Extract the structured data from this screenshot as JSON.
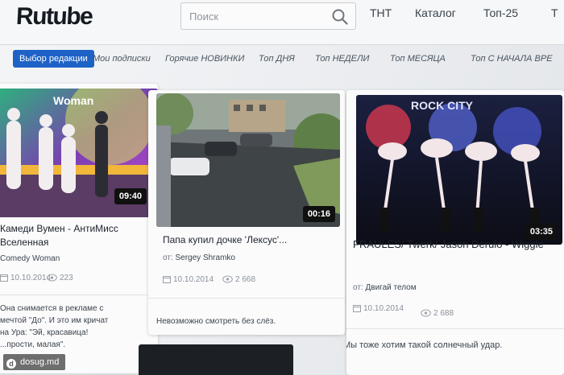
{
  "header": {
    "logo": "Rutube",
    "search_placeholder": "Поиск",
    "nav": [
      "ТНТ",
      "Каталог",
      "Топ-25",
      "Т"
    ]
  },
  "tabs": [
    {
      "label": "Выбор редакции",
      "active": true
    },
    {
      "label": "Мои подписки"
    },
    {
      "label": "Горячие НОВИНКИ"
    },
    {
      "label": "Топ ДНЯ"
    },
    {
      "label": "Топ НЕДЕЛИ"
    },
    {
      "label": "Топ МЕСЯЦА"
    },
    {
      "label": "Топ С НАЧАЛА ВРЕ"
    }
  ],
  "cards": [
    {
      "thumb_text": "Woman",
      "duration": "09:40",
      "title": "Камеди Вумен - АнтиМисс Вселенная",
      "author": "Comedy Woman",
      "date": "10.10.2014",
      "views": "223",
      "comment": "Она снимается в рекламе с мечтой \"До\". И это им кричат на Ура: \"Эй, красавица! ...прости, малая\"."
    },
    {
      "duration": "00:16",
      "title": "Папа купил дочке 'Лексус'...",
      "author_prefix": "от:",
      "author": "Sergey Shramko",
      "date": "10.10.2014",
      "views": "2 668",
      "comment": "Невозможно смотреть без слёз."
    },
    {
      "thumb_text": "ROCK CITY",
      "duration": "03:35",
      "title": "FRAULES/ Twerk/ Jason Derulo - Wiggle",
      "author_prefix": "от:",
      "author": "Двигай телом",
      "date": "10.10.2014",
      "views": "2 688",
      "comment": "Мы тоже хотим такой солнечный удар."
    }
  ],
  "watermark": "dosug.md",
  "colors": {
    "accent": "#1e62c7",
    "text": "#1c232b"
  }
}
